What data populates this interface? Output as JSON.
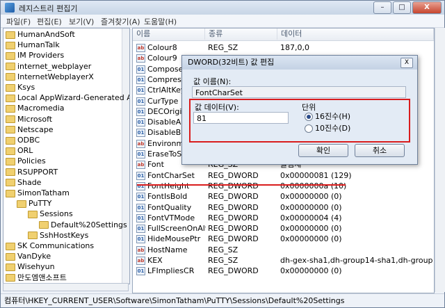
{
  "window": {
    "title": "레지스트리 편집기",
    "min": "–",
    "max": "□",
    "close": "X"
  },
  "menu": [
    "파일(F)",
    "편집(E)",
    "보기(V)",
    "즐겨찾기(A)",
    "도움말(H)"
  ],
  "tree": [
    {
      "label": "HumanAndSoft",
      "indent": 0
    },
    {
      "label": "HumanTalk",
      "indent": 0
    },
    {
      "label": "IM Providers",
      "indent": 0
    },
    {
      "label": "internet_webplayer",
      "indent": 0
    },
    {
      "label": "InternetWebplayerX",
      "indent": 0
    },
    {
      "label": "Ksys",
      "indent": 0
    },
    {
      "label": "Local AppWizard-Generated Applic",
      "indent": 0
    },
    {
      "label": "Macromedia",
      "indent": 0
    },
    {
      "label": "Microsoft",
      "indent": 0
    },
    {
      "label": "Netscape",
      "indent": 0
    },
    {
      "label": "ODBC",
      "indent": 0
    },
    {
      "label": "ORL",
      "indent": 0
    },
    {
      "label": "Policies",
      "indent": 0
    },
    {
      "label": "RSUPPORT",
      "indent": 0
    },
    {
      "label": "Shade",
      "indent": 0
    },
    {
      "label": "SimonTatham",
      "indent": 0
    },
    {
      "label": "PuTTY",
      "indent": 1
    },
    {
      "label": "Sessions",
      "indent": 2
    },
    {
      "label": "Default%20Settings",
      "indent": 3
    },
    {
      "label": "SshHostKeys",
      "indent": 2
    },
    {
      "label": "SK Communications",
      "indent": 0
    },
    {
      "label": "VanDyke",
      "indent": 0
    },
    {
      "label": "Wisehyun",
      "indent": 0
    },
    {
      "label": "만도엠앤소프트",
      "indent": 0
    }
  ],
  "columns": {
    "name": "이름",
    "type": "종류",
    "data": "데이터"
  },
  "values": [
    {
      "name": "Colour8",
      "type": "REG_SZ",
      "data": "187,0,0",
      "kind": "sz"
    },
    {
      "name": "Colour9",
      "type": "",
      "data": "",
      "kind": "sz"
    },
    {
      "name": "ComposeK",
      "type": "",
      "data": "",
      "kind": "bin"
    },
    {
      "name": "Compressio",
      "type": "",
      "data": "",
      "kind": "bin"
    },
    {
      "name": "CtrlAltKeys",
      "type": "",
      "data": "",
      "kind": "bin"
    },
    {
      "name": "CurType",
      "type": "",
      "data": "",
      "kind": "bin"
    },
    {
      "name": "DECOriginN",
      "type": "",
      "data": "",
      "kind": "bin"
    },
    {
      "name": "DisableArab",
      "type": "",
      "data": "",
      "kind": "bin"
    },
    {
      "name": "DisableBidi",
      "type": "",
      "data": "",
      "kind": "bin"
    },
    {
      "name": "Environmen",
      "type": "",
      "data": "",
      "kind": "sz"
    },
    {
      "name": "EraseToScro",
      "type": "",
      "data": "",
      "kind": "bin"
    },
    {
      "name": "Font",
      "type": "REG_SZ",
      "data": "굴림체",
      "kind": "sz"
    },
    {
      "name": "FontCharSet",
      "type": "REG_DWORD",
      "data": "0x00000081 (129)",
      "kind": "bin"
    },
    {
      "name": "FontHeight",
      "type": "REG_DWORD",
      "data": "0x0000000a (10)",
      "kind": "bin"
    },
    {
      "name": "FontIsBold",
      "type": "REG_DWORD",
      "data": "0x00000000 (0)",
      "kind": "bin"
    },
    {
      "name": "FontQuality",
      "type": "REG_DWORD",
      "data": "0x00000000 (0)",
      "kind": "bin"
    },
    {
      "name": "FontVTMode",
      "type": "REG_DWORD",
      "data": "0x00000004 (4)",
      "kind": "bin"
    },
    {
      "name": "FullScreenOnAlt...",
      "type": "REG_DWORD",
      "data": "0x00000000 (0)",
      "kind": "bin"
    },
    {
      "name": "HideMousePtr",
      "type": "REG_DWORD",
      "data": "0x00000000 (0)",
      "kind": "bin"
    },
    {
      "name": "HostName",
      "type": "REG_SZ",
      "data": "",
      "kind": "sz"
    },
    {
      "name": "KEX",
      "type": "REG_SZ",
      "data": "dh-gex-sha1,dh-group14-sha1,dh-group1-sha1,...",
      "kind": "sz"
    },
    {
      "name": "LFImpliesCR",
      "type": "REG_DWORD",
      "data": "0x00000000 (0)",
      "kind": "bin"
    }
  ],
  "dialog": {
    "title": "DWORD(32비트) 값 편집",
    "close": "X",
    "name_label": "값 이름(N):",
    "name_value": "FontCharSet",
    "data_label": "값 데이터(V):",
    "data_value": "81",
    "base_label": "단위",
    "radio_hex": "16진수(H)",
    "radio_dec": "10진수(D)",
    "selected": "hex",
    "ok": "확인",
    "cancel": "취소"
  },
  "status": "컴퓨터\\HKEY_CURRENT_USER\\Software\\SimonTatham\\PuTTY\\Sessions\\Default%20Settings"
}
